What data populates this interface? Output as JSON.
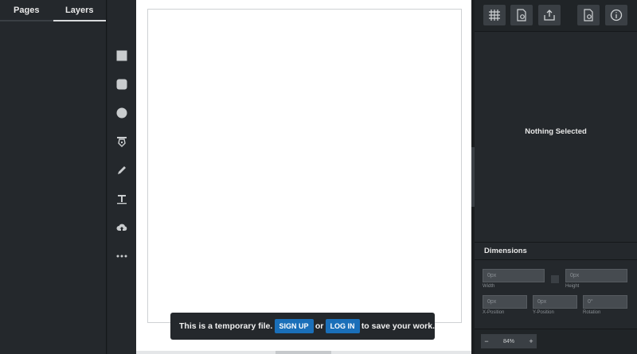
{
  "left_panel": {
    "tabs": [
      {
        "label": "Pages"
      },
      {
        "label": "Layers"
      }
    ]
  },
  "tools": [
    {
      "name": "rectangle-tool",
      "icon": "square-icon"
    },
    {
      "name": "rounded-rectangle-tool",
      "icon": "rounded-square-icon"
    },
    {
      "name": "ellipse-tool",
      "icon": "circle-icon"
    },
    {
      "name": "pen-tool",
      "icon": "pen-nib-icon"
    },
    {
      "name": "pencil-tool",
      "icon": "pencil-icon"
    },
    {
      "name": "text-tool",
      "icon": "text-icon"
    },
    {
      "name": "upload-tool",
      "icon": "cloud-upload-icon"
    },
    {
      "name": "more-tools",
      "icon": "ellipsis-icon"
    }
  ],
  "toolbar": [
    {
      "name": "grid-button",
      "icon": "grid-icon"
    },
    {
      "name": "page-settings-button",
      "icon": "page-gear-icon"
    },
    {
      "name": "export-button",
      "icon": "share-icon"
    },
    {
      "name": "document-settings-button",
      "icon": "document-gear-icon"
    },
    {
      "name": "info-button",
      "icon": "info-icon"
    }
  ],
  "inspector": {
    "empty_state": "Nothing Selected"
  },
  "dimensions": {
    "title": "Dimensions",
    "width": {
      "value": "0px",
      "label": "Width"
    },
    "height": {
      "value": "0px",
      "label": "Height"
    },
    "x": {
      "value": "0px",
      "label": "X-Position"
    },
    "y": {
      "value": "0px",
      "label": "Y-Position"
    },
    "rotation": {
      "value": "0°",
      "label": "Rotation"
    }
  },
  "zoom": {
    "minus": "−",
    "value": "84%",
    "plus": "+"
  },
  "notice": {
    "text_before": "This is a temporary file.",
    "signup_label": "SIGN UP",
    "or_text": "or",
    "login_label": "LOG IN",
    "text_after": "to save your work."
  },
  "colors": {
    "accent": "#1a6fb9",
    "panel": "#24282c",
    "canvas": "#ffffff"
  }
}
